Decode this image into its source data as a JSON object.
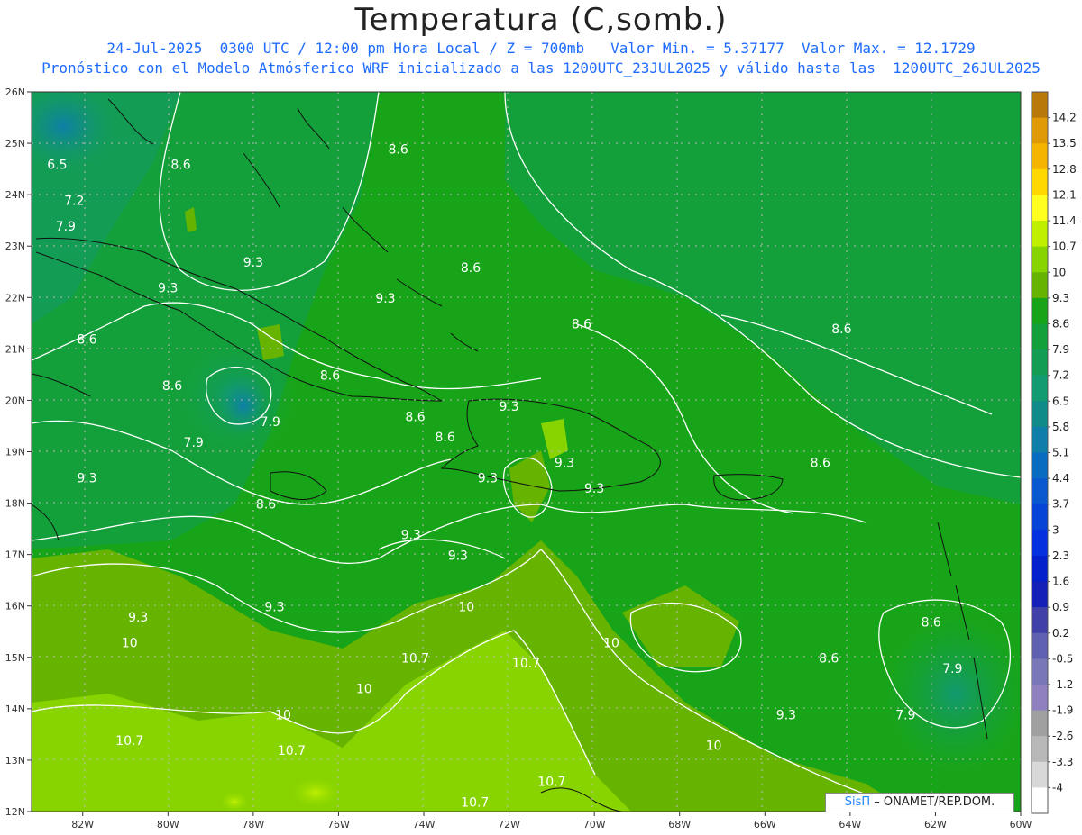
{
  "title": "Temperatura (C,somb.)",
  "subtitle_line1": "24-Jul-2025  0300 UTC / 12:00 pm Hora Local / Z = 700mb   Valor Min. = 5.37177  Valor Max. = 12.1729",
  "subtitle_line2": "Pronóstico con el Modelo Atmósferico WRF inicializado a las 1200UTC_23JUL2025 y válido hasta las  1200UTC_26JUL2025",
  "credit": {
    "brand": "SisΠ",
    "text": "– ONAMET/REP.DOM."
  },
  "map": {
    "lon_range": [
      -83.2,
      -60.0
    ],
    "lat_range": [
      12.0,
      26.0
    ],
    "lon_ticks": [
      "82W",
      "80W",
      "78W",
      "76W",
      "74W",
      "72W",
      "70W",
      "68W",
      "66W",
      "64W",
      "62W",
      "60W"
    ],
    "lat_ticks": [
      "26N",
      "25N",
      "24N",
      "23N",
      "22N",
      "21N",
      "20N",
      "19N",
      "18N",
      "17N",
      "16N",
      "15N",
      "14N",
      "13N",
      "12N"
    ]
  },
  "colorbar": {
    "labels": [
      "14.2",
      "13.5",
      "12.8",
      "12.1",
      "11.4",
      "10.7",
      "10",
      "9.3",
      "8.6",
      "7.9",
      "7.2",
      "6.5",
      "5.8",
      "5.1",
      "4.4",
      "3.7",
      "3",
      "2.3",
      "1.6",
      "0.9",
      "0.2",
      "-0.5",
      "-1.2",
      "-1.9",
      "-2.6",
      "-3.3",
      "-4"
    ],
    "colors": [
      "#b8780a",
      "#e09a08",
      "#f5b400",
      "#ffd800",
      "#ffff20",
      "#bff000",
      "#88d400",
      "#66b400",
      "#18a418",
      "#13a03a",
      "#139c54",
      "#129a70",
      "#118a8a",
      "#0f7ea8",
      "#0a6cc0",
      "#0858d0",
      "#0644d8",
      "#0430e0",
      "#0420cc",
      "#1420b8",
      "#4040a8",
      "#6060b0",
      "#7878b8",
      "#9080c0",
      "#a0a0a0",
      "#b8b8b8",
      "#d8d8d8",
      "#ffffff"
    ]
  },
  "contour_labels": [
    {
      "text": "8.6",
      "lon": -74.6,
      "lat": 24.8
    },
    {
      "text": "6.5",
      "lon": -82.6,
      "lat": 24.5
    },
    {
      "text": "8.6",
      "lon": -79.7,
      "lat": 24.5
    },
    {
      "text": "7.2",
      "lon": -82.2,
      "lat": 23.8
    },
    {
      "text": "7.9",
      "lon": -82.4,
      "lat": 23.3
    },
    {
      "text": "9.3",
      "lon": -78.0,
      "lat": 22.6
    },
    {
      "text": "8.6",
      "lon": -72.9,
      "lat": 22.5
    },
    {
      "text": "9.3",
      "lon": -80.0,
      "lat": 22.1
    },
    {
      "text": "9.3",
      "lon": -74.9,
      "lat": 21.9
    },
    {
      "text": "8.6",
      "lon": -70.3,
      "lat": 21.4
    },
    {
      "text": "8.6",
      "lon": -64.2,
      "lat": 21.3
    },
    {
      "text": "8.6",
      "lon": -81.9,
      "lat": 21.1
    },
    {
      "text": "8.6",
      "lon": -76.2,
      "lat": 20.4
    },
    {
      "text": "8.6",
      "lon": -79.9,
      "lat": 20.2
    },
    {
      "text": "9.3",
      "lon": -72.0,
      "lat": 19.8
    },
    {
      "text": "8.6",
      "lon": -74.2,
      "lat": 19.6
    },
    {
      "text": "7.9",
      "lon": -77.6,
      "lat": 19.5
    },
    {
      "text": "8.6",
      "lon": -73.5,
      "lat": 19.2
    },
    {
      "text": "7.9",
      "lon": -79.4,
      "lat": 19.1
    },
    {
      "text": "9.3",
      "lon": -70.7,
      "lat": 18.7
    },
    {
      "text": "8.6",
      "lon": -64.7,
      "lat": 18.7
    },
    {
      "text": "9.3",
      "lon": -72.5,
      "lat": 18.4
    },
    {
      "text": "9.3",
      "lon": -81.9,
      "lat": 18.4
    },
    {
      "text": "9.3",
      "lon": -70.0,
      "lat": 18.2
    },
    {
      "text": "8.6",
      "lon": -77.7,
      "lat": 17.9
    },
    {
      "text": "9.3",
      "lon": -74.3,
      "lat": 17.3
    },
    {
      "text": "9.3",
      "lon": -73.2,
      "lat": 16.9
    },
    {
      "text": "10",
      "lon": -73.0,
      "lat": 15.9
    },
    {
      "text": "9.3",
      "lon": -77.5,
      "lat": 15.9
    },
    {
      "text": "9.3",
      "lon": -80.7,
      "lat": 15.7
    },
    {
      "text": "8.6",
      "lon": -62.1,
      "lat": 15.6
    },
    {
      "text": "10",
      "lon": -80.9,
      "lat": 15.2
    },
    {
      "text": "10",
      "lon": -69.6,
      "lat": 15.2
    },
    {
      "text": "10.7",
      "lon": -74.2,
      "lat": 14.9
    },
    {
      "text": "8.6",
      "lon": -64.5,
      "lat": 14.9
    },
    {
      "text": "10.7",
      "lon": -71.6,
      "lat": 14.8
    },
    {
      "text": "7.9",
      "lon": -61.6,
      "lat": 14.7
    },
    {
      "text": "10",
      "lon": -75.4,
      "lat": 14.3
    },
    {
      "text": "10",
      "lon": -77.3,
      "lat": 13.8
    },
    {
      "text": "9.3",
      "lon": -65.5,
      "lat": 13.8
    },
    {
      "text": "7.9",
      "lon": -62.7,
      "lat": 13.8
    },
    {
      "text": "10.7",
      "lon": -80.9,
      "lat": 13.3
    },
    {
      "text": "10",
      "lon": -67.2,
      "lat": 13.2
    },
    {
      "text": "10.7",
      "lon": -77.1,
      "lat": 13.1
    },
    {
      "text": "10.7",
      "lon": -71.0,
      "lat": 12.5
    },
    {
      "text": "10.7",
      "lon": -72.8,
      "lat": 12.1
    }
  ]
}
